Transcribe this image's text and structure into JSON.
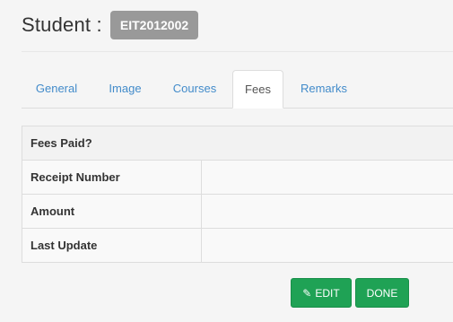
{
  "header": {
    "label": "Student :",
    "student_id": "EIT2012002"
  },
  "tabs": [
    {
      "label": "General",
      "active": false
    },
    {
      "label": "Image",
      "active": false
    },
    {
      "label": "Courses",
      "active": false
    },
    {
      "label": "Fees",
      "active": true
    },
    {
      "label": "Remarks",
      "active": false
    }
  ],
  "fees": {
    "heading": "Fees Paid?",
    "rows": [
      {
        "label": "Receipt Number",
        "value": ""
      },
      {
        "label": "Amount",
        "value": ""
      },
      {
        "label": "Last Update",
        "value": ""
      }
    ]
  },
  "actions": {
    "edit_label": "EDIT",
    "done_label": "DONE",
    "button_color": "#1fa255"
  },
  "icons": {
    "edit": "pencil-icon"
  }
}
